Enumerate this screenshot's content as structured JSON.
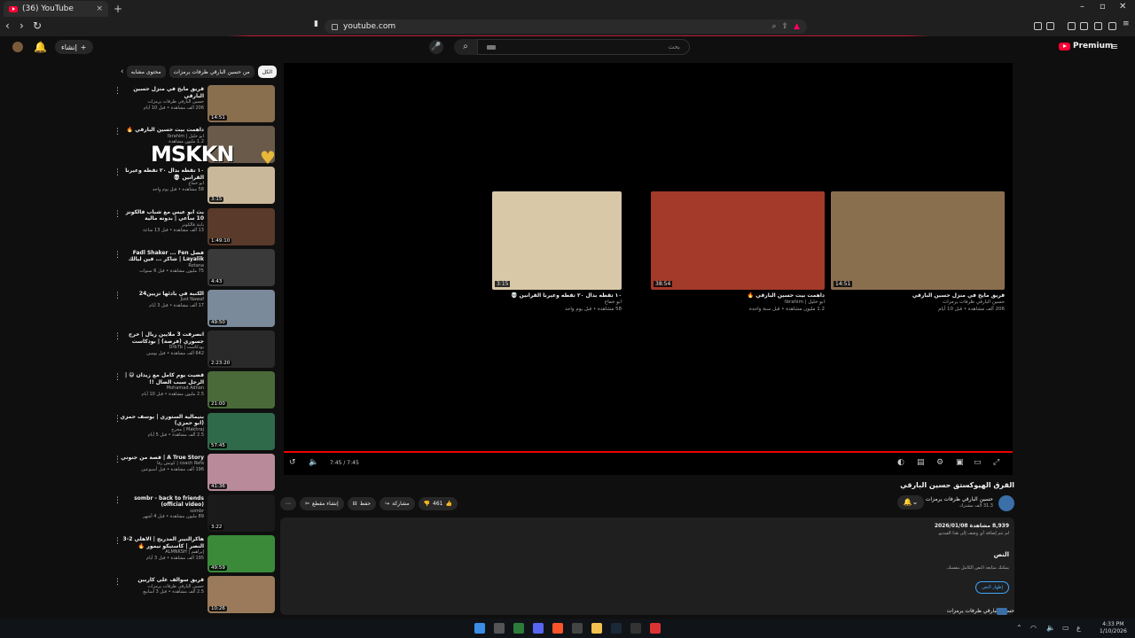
{
  "browser": {
    "tab_title": "(36) YouTube",
    "url": "youtube.com",
    "new_tab": "+",
    "close_tab": "×"
  },
  "yt_header": {
    "create_label": "إنشاء",
    "notif_count": "",
    "search_placeholder": "بحث",
    "premium_label": "Premium"
  },
  "chips": [
    "الكل",
    "من حسين البارقي ظرفات يرمزات",
    "محتوى مشابه"
  ],
  "recommendations": [
    {
      "title": "قريق مايخ في منزل حسين البارقي",
      "channel": "حسين البارقي ظرفات يرمزات",
      "views": "206 ألف مشاهدة • قبل 10 أيام",
      "duration": "14:51",
      "thumb": "#8a6f4f"
    },
    {
      "title": "داهمت بيت حسين البارقي 🔥",
      "channel": "ابو خليل | Ibrahim",
      "views": "1.2 مليون مشاهدة",
      "duration": "",
      "thumb": "#6a5a4a"
    },
    {
      "title": "١٠ تقطه بدال ٢٠ تقطه وعيرنا القرانين 💀",
      "channel": "ابو خماع",
      "views": "58 مشاهدة • قبل يوم واحد",
      "duration": "3:15",
      "thumb": "#c9b89a"
    },
    {
      "title": "بث ابو عيس مع شباب فالكونز 10 ساعي | بدونه مالية",
      "channel": "بايتة فالكونز",
      "views": "13 ألف مشاهدة • قبل 13 ساعة",
      "duration": "1:49:10",
      "thumb": "#5a3a2a"
    },
    {
      "title": "فضل Fadl Shaker ... Fen Layalik | شاكر ... فين ليالك",
      "channel": "Rotana",
      "views": "75 مليون مشاهدة • قبل 6 سنوات",
      "duration": "4:43",
      "thumb": "#3a3a3a"
    },
    {
      "title": "الكنبة في بادئها تزيين24",
      "channel": "Just Nawaf",
      "views": "17 ألف مشاهدة • قبل 3 أيام",
      "duration": "49:50",
      "thumb": "#7a8a9a"
    },
    {
      "title": "انصرفت 3 ملايين ريال | خرج جسوري (فرصة) | بودكاست بسنير علي",
      "channel": "بودكاست | Drb7b",
      "views": "642 ألف مشاهدة • قبل يومين",
      "duration": "2:23:20",
      "thumb": "#2a2a2a"
    },
    {
      "title": "قضيت يوم كامل مع زيدان 😅 | الرجل سبب الضال !!",
      "channel": "Mohamad Adnan",
      "views": "2.5 مليون مشاهدة • قبل 10 أيام",
      "duration": "21:00",
      "thumb": "#4a6a3a"
    },
    {
      "title": "بنيمالية الستوري | يوسف حمزي (ابو حمزي)",
      "channel": "Makhraj | مخرج",
      "views": "2.5 ألف مشاهدة • قبل 5 أيام",
      "duration": "57:45",
      "thumb": "#2f6a4a"
    },
    {
      "title": "A True Story | قصة من جنوني",
      "channel": "coach Refa | كوتش رفا",
      "views": "196 ألف مشاهدة • قبل أسبوعين",
      "duration": "41:36",
      "thumb": "#b88a9a"
    },
    {
      "title": "sombr - back to friends (official video)",
      "channel": "sombr",
      "views": "89 مليون مشاهدة • قبل 4 أشهر",
      "duration": "3:22",
      "thumb": "#1a1a1a"
    },
    {
      "title": "هاكرالنيبر المدريج | الاهلي 2-3 النصر | كاستيكو نيمور 🔥",
      "channel": "إبراهيم | ALMNKSH",
      "views": "195 ألف مشاهدة • قبل 3 أيام",
      "duration": "49:59",
      "thumb": "#3a8a3a"
    },
    {
      "title": "قريق سوالف على كاربين",
      "channel": "حسين البارقي ظرفات يرمزات",
      "views": "2.5 ألف مشاهدة • قبل 3 أسابيع",
      "duration": "10:26",
      "thumb": "#9a7a5a"
    }
  ],
  "endcards": [
    {
      "title": "قريق مايخ في منزل حسين البارقي",
      "channel": "حسين البارقي ظرفات يرمزات",
      "views": "206 ألف مشاهدة • قبل 10 أيام",
      "duration": "14:51",
      "color": "#8a6f4f"
    },
    {
      "title": "داهمت بيت حسين البارقي 🔥",
      "channel": "ابو خليل | Ibrahim",
      "views": "1.2 مليون مشاهدة • قبل سنة واحدة",
      "duration": "38:54",
      "color": "#a33a2a"
    },
    {
      "title": "١٠ تقطه بدال ٢٠ تقطه وعيرنا القرانين 💀",
      "channel": "ابو خماع",
      "views": "58 مشاهدة • قبل يوم واحد",
      "duration": "3:15",
      "color": "#d8c8a8"
    }
  ],
  "player": {
    "time": "7:45 / 7:45",
    "progress": 1.0
  },
  "video": {
    "title": "القرق الهيوكستق حسين البارقي",
    "channel": "حسين البارقي ظرفات يرمزات",
    "subs": "31.3 ألف مشترك",
    "likes": "461",
    "share": "مشاركة",
    "save": "حفظ",
    "clip": "إنشاء مقطع",
    "stats": "8,939 مشاهدة 2026/01/08",
    "no_desc": "لم تتم إضافة أي وصف إلى هذا الفيديو.",
    "transcript_heading": "النص",
    "transcript_sub": "يمكنك متابعة النص الكامل بنفسك.",
    "transcript_btn": "إظهار النص"
  },
  "overlay": {
    "brand": "MSKKN"
  },
  "taskbar": {
    "time": "4:33 PM",
    "date": "1/10/2026"
  },
  "colors": {
    "accent": "#ff0033",
    "progress": "#ee0000",
    "link": "#3ea6ff"
  }
}
